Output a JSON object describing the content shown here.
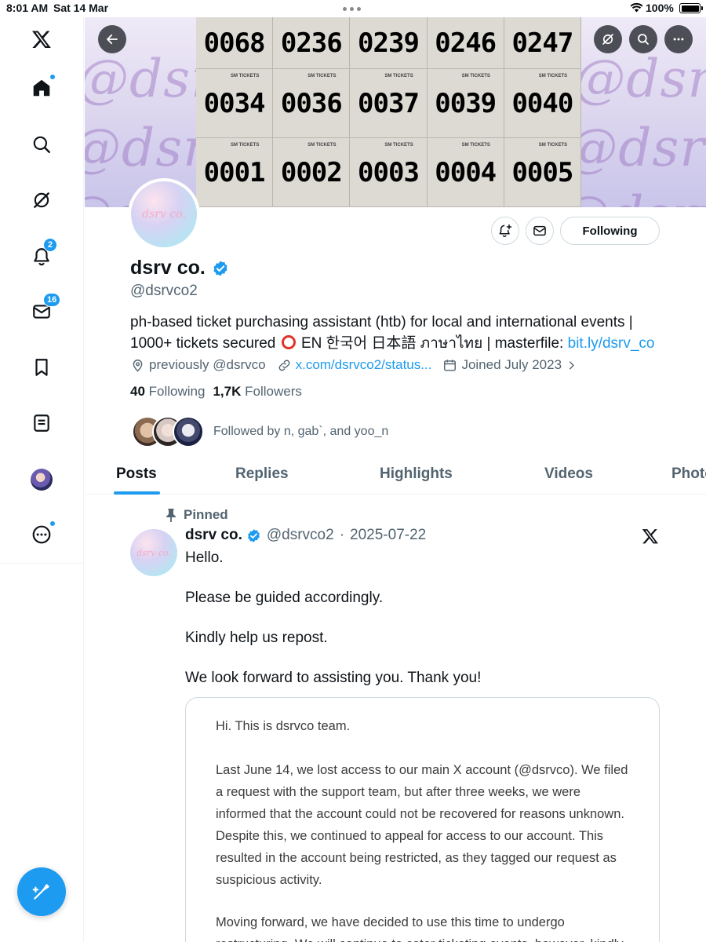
{
  "status_bar": {
    "time": "8:01 AM",
    "date": "Sat 14 Mar",
    "battery": "100%"
  },
  "sidebar": {
    "items": [
      {
        "name": "x-logo",
        "badge": ""
      },
      {
        "name": "home",
        "badge": ""
      },
      {
        "name": "explore",
        "badge": ""
      },
      {
        "name": "grok",
        "badge": ""
      },
      {
        "name": "notifications",
        "badge": "2"
      },
      {
        "name": "messages",
        "badge": "16"
      },
      {
        "name": "bookmarks",
        "badge": ""
      },
      {
        "name": "lists",
        "badge": ""
      },
      {
        "name": "profile",
        "badge": ""
      },
      {
        "name": "more",
        "badge": ""
      }
    ]
  },
  "banner": {
    "watermark": "@dsrvco @dsrvco @dsrvco",
    "ticket_rows": [
      [
        "0068",
        "0236",
        "0239",
        "0246",
        "0247"
      ],
      [
        "0034",
        "0036",
        "0037",
        "0039",
        "0040"
      ],
      [
        "0001",
        "0002",
        "0003",
        "0004",
        "0005"
      ]
    ],
    "ticket_brand": "SM TICKETS"
  },
  "profile": {
    "avatar_text": "dsrv co.",
    "display_name": "dsrv co.",
    "handle": "@dsrvco2",
    "following_button": "Following",
    "bio_line1": "ph-based ticket purchasing assistant (htb) for local and international events |",
    "bio_line2_pre": "1000+ tickets secured",
    "bio_line2_post": "EN 한국어 日本語 ภาษาไทย | masterfile:",
    "bio_link": "bit.ly/dsrv_co",
    "location": "previously @dsrvco",
    "website": "x.com/dsrvco2/status...",
    "joined": "Joined July 2023",
    "following_count": "40",
    "following_label": "Following",
    "followers_count": "1,7K",
    "followers_label": "Followers",
    "followed_by": "Followed by n, gab`, and yoo_n"
  },
  "tabs": [
    "Posts",
    "Replies",
    "Highlights",
    "Videos",
    "Photos"
  ],
  "post": {
    "pinned_label": "Pinned",
    "name": "dsrv co.",
    "handle": "@dsrvco2",
    "sep": "·",
    "date": "2025-07-22",
    "lines": [
      "Hello.",
      "Please be guided accordingly.",
      "Kindly help us repost.",
      "We look forward to assisting you. Thank you!"
    ],
    "quote_lines": [
      "Hi. This is dsrvco team.",
      "Last June 14, we lost access to our main X account (@dsrvco). We filed",
      "a request with the support team, but after three weeks, we were",
      "informed that the account could not be recovered for reasons unknown.",
      "Despite this, we continued to appeal for access to our account. This",
      "resulted in the account being restricted, as they tagged our request as",
      "suspicious activity.",
      "Moving forward, we have decided to use this time to undergo",
      "restructuring. We will continue to cater ticketing events, however, kindly"
    ]
  },
  "colors": {
    "accent": "#1d9bf0",
    "text": "#0f1419",
    "muted": "#536471",
    "border": "#cfd9de"
  }
}
